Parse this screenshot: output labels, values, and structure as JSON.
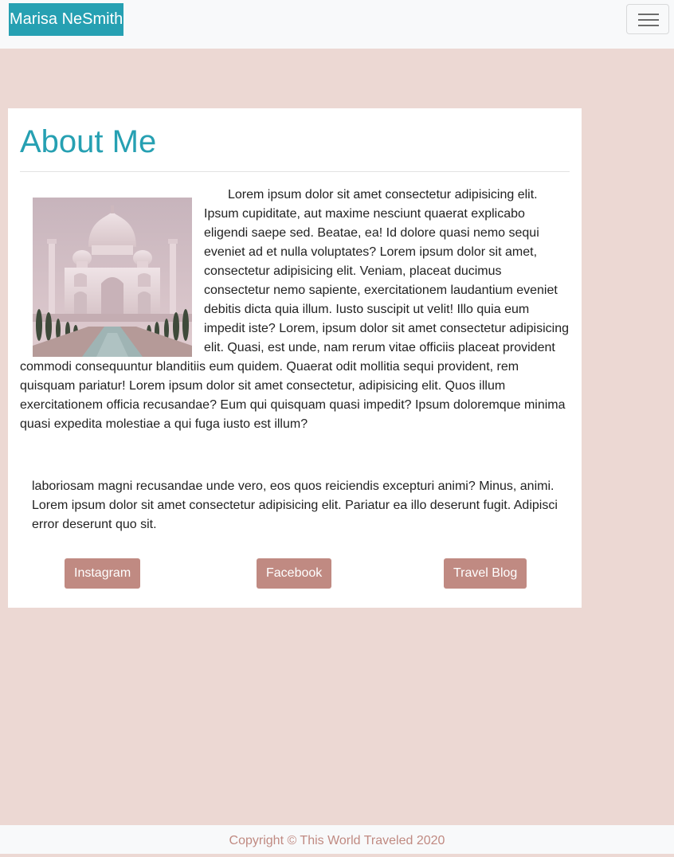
{
  "navbar": {
    "brand": "Marisa NeSmith",
    "toggle_icon": "hamburger-menu-icon"
  },
  "about": {
    "title": "About Me",
    "photo_subject": "taj-mahal-photo",
    "paragraph_1": "Lorem ipsum dolor sit amet consectetur adipisicing elit. Ipsum cupiditate, aut maxime nesciunt quaerat explicabo eligendi saepe sed. Beatae, ea! Id dolore quasi nemo sequi eveniet ad et nulla voluptates? Lorem ipsum dolor sit amet, consectetur adipisicing elit. Veniam, placeat ducimus consectetur nemo sapiente, exercitationem laudantium eveniet debitis dicta quia illum. Iusto suscipit ut velit! Illo quia eum impedit iste? Lorem, ipsum dolor sit amet consectetur adipisicing elit. Quasi, est unde, nam rerum vitae officiis placeat provident commodi consequuntur blanditiis eum quidem. Quaerat odit mollitia sequi provident, rem quisquam pariatur! Lorem ipsum dolor sit amet consectetur, adipisicing elit. Quos illum exercitationem officia recusandae? Eum qui quisquam quasi impedit? Ipsum doloremque minima quasi expedita molestiae a qui fuga iusto est illum?",
    "paragraph_2": "laboriosam magni recusandae unde vero, eos quos reiciendis excepturi animi? Minus, animi. Lorem ipsum dolor sit amet consectetur adipisicing elit. Pariatur ea illo deserunt fugit. Adipisci error deserunt quo sit."
  },
  "social": {
    "instagram": "Instagram",
    "facebook": "Facebook",
    "travel_blog": "Travel Blog"
  },
  "footer": {
    "copyright": "Copyright © This World Traveled 2020"
  },
  "colors": {
    "page_background": "#ecd8d3",
    "accent_teal": "#26a0b2",
    "button_rose": "#c08a82",
    "navbar_background": "#f8f9fa"
  }
}
